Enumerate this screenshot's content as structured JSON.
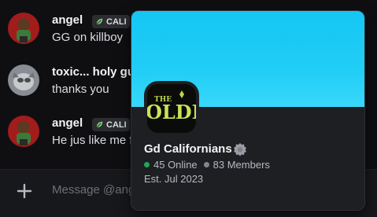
{
  "messages": [
    {
      "username": "angel",
      "tag": "CALI",
      "text": "GG on killboy"
    },
    {
      "username": "toxic... holy gu",
      "tag": "",
      "text": "thanks you"
    },
    {
      "username": "angel",
      "tag": "CALI",
      "text": "He jus like me f"
    }
  ],
  "composer": {
    "placeholder": "Message @ang"
  },
  "popout": {
    "icon_text": "THE OLDE",
    "server_name": "Gd Californians",
    "online": "45 Online",
    "members": "83 Members",
    "established": "Est. Jul 2023"
  }
}
